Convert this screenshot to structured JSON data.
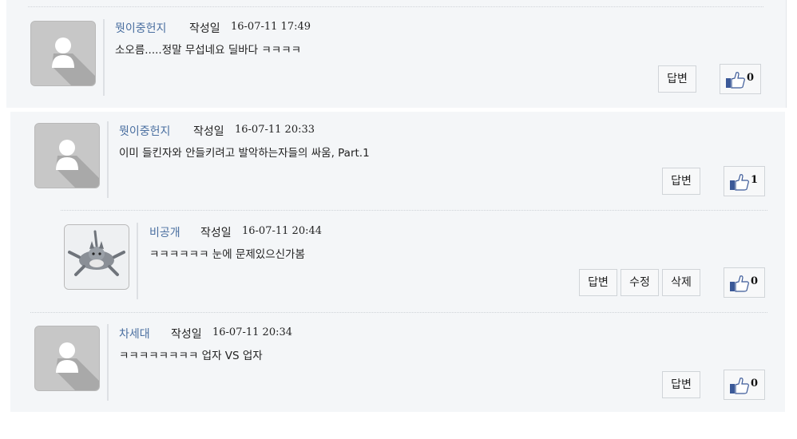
{
  "labels": {
    "written_on": "작성일",
    "reply": "답변",
    "edit": "수정",
    "delete": "삭제"
  },
  "comments": [
    {
      "author": "뭣이중헌지",
      "date": "16-07-11 17:49",
      "text": "소오름.....정말 무섭네요 딜바다 ㅋㅋㅋㅋ",
      "likes": "0",
      "avatar": "default-user-icon"
    },
    {
      "author": "뭣이중헌지",
      "date": "16-07-11 20:33",
      "text": "이미 들킨자와 안들키려고 발악하는자들의 싸움, Part.1",
      "likes": "1",
      "avatar": "default-user-icon"
    },
    {
      "author": "비공개",
      "date": "16-07-11 20:44",
      "text": "ㅋㅋㅋㅋㅋㅋ 눈에 문제있으신가봄",
      "likes": "0",
      "avatar": "cat-photo"
    },
    {
      "author": "차세대",
      "date": "16-07-11 20:34",
      "text": "ㅋㅋㅋㅋㅋㅋㅋㅋ 업자 VS 업자",
      "likes": "0",
      "avatar": "default-user-icon"
    }
  ],
  "colors": {
    "author": "#4a6fa0",
    "panel": "#f4f6f8",
    "thumb": "#3b5998"
  }
}
